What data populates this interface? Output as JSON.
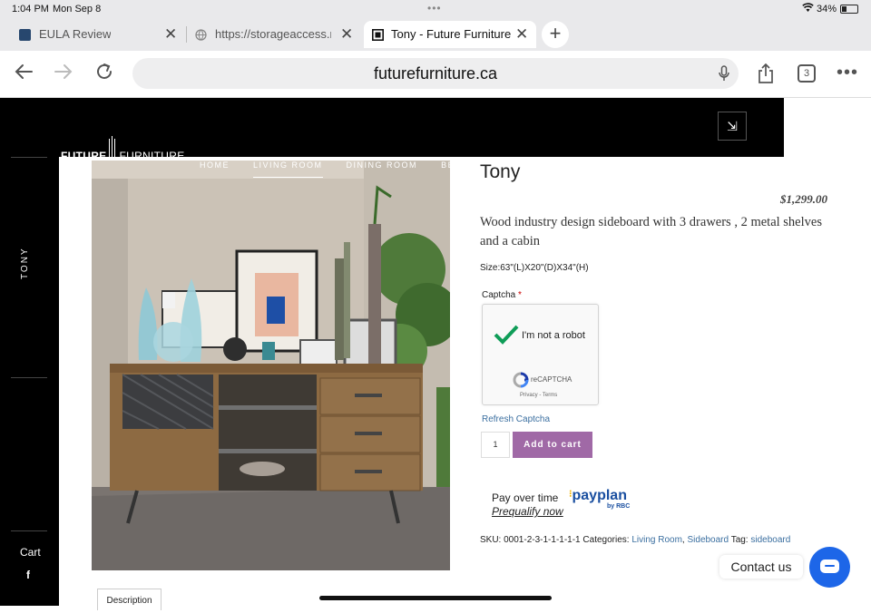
{
  "status": {
    "time": "1:04 PM",
    "date": "Mon Sep 8",
    "battery": "34%"
  },
  "tabs": [
    {
      "label": "EULA Review"
    },
    {
      "label": "https://storageaccess.ne"
    },
    {
      "label": "Tony - Future Furniture"
    }
  ],
  "toolbar": {
    "url": "futurefurniture.ca",
    "tab_count": "3"
  },
  "header": {
    "logo_left": "FUTURE",
    "logo_right": "FURNITURE"
  },
  "nav": [
    "HOME",
    "LIVING ROOM",
    "DINING ROOM",
    "BED ROO"
  ],
  "sidebar": {
    "title": "TONY",
    "cart": "Cart",
    "social": "f"
  },
  "product": {
    "title": "Tony",
    "price": "$1,299.00",
    "description": "Wood industry design sideboard with 3 drawers , 2 metal shelves and a cabin",
    "size": "Size:63\"(L)X20\"(D)X34\"(H)",
    "captcha_label": "Captcha",
    "captcha_required": "*",
    "captcha_text": "I'm not a robot",
    "recaptcha_name": "reCAPTCHA",
    "recaptcha_terms": "Privacy - Terms",
    "refresh_captcha": "Refresh Captcha",
    "quantity": "1",
    "add_to_cart": "Add to cart",
    "pay_over_time": "Pay over time",
    "prequalify": "Prequalify now",
    "payplan": "payplan",
    "payplan_by": "by RBC",
    "sku_label": "SKU:",
    "sku": "0001-2-3-1-1-1-1-1",
    "categories_label": "Categories:",
    "category_1": "Living Room",
    "category_2": "Sideboard",
    "tag_label": "Tag:",
    "tag": "sideboard",
    "description_tab": "Description"
  },
  "chat": {
    "label": "Contact us"
  },
  "colors": {
    "accent": "#a069a6",
    "link": "#3b6fa0",
    "chat": "#1d66e8"
  }
}
